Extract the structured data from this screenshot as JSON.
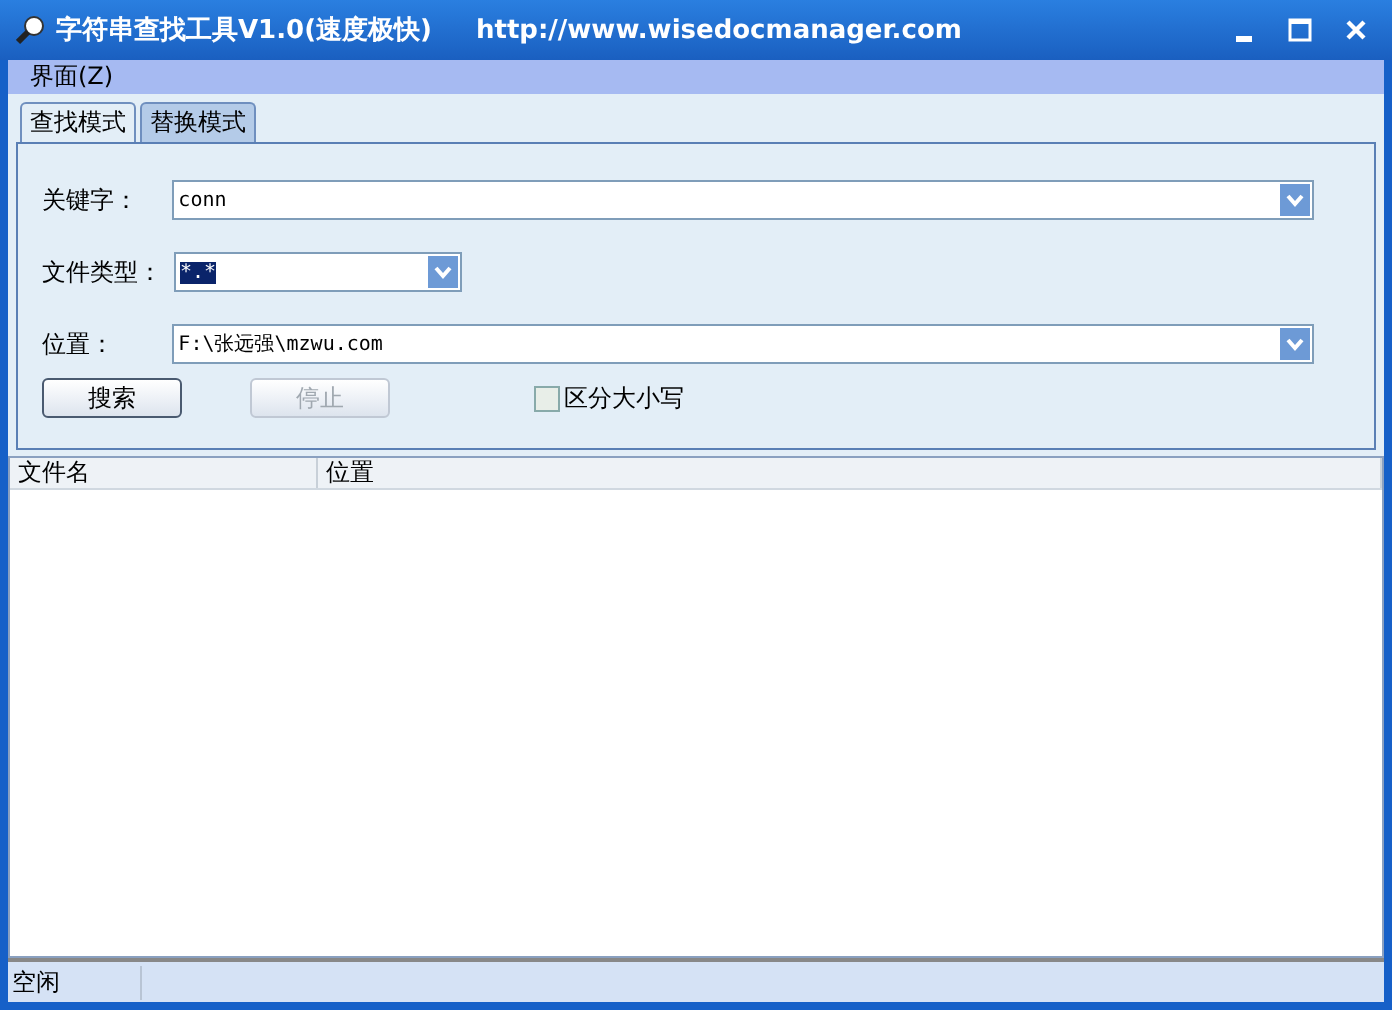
{
  "window": {
    "title": "字符串查找工具V1.0(速度极快)",
    "url": "http://www.wisedocmanager.com"
  },
  "menu": [
    {
      "label": "界面(Z)"
    }
  ],
  "tabs": [
    {
      "label": "查找模式",
      "selected": true
    },
    {
      "label": "替换模式",
      "selected": false
    }
  ],
  "fields": [
    {
      "label": "关键字：",
      "value": "conn",
      "kind": "wide",
      "highlighted": false
    },
    {
      "label": "文件类型：",
      "value": "*.*",
      "kind": "narrow",
      "highlighted": true
    },
    {
      "label": "位置：",
      "value": "F:\\张远强\\mzwu.com",
      "kind": "wide",
      "highlighted": false
    }
  ],
  "buttons": [
    {
      "label": "搜索",
      "disabled": false
    },
    {
      "label": "停止",
      "disabled": true
    }
  ],
  "checkbox": {
    "label": "区分大小写",
    "checked": false
  },
  "table": {
    "columns": [
      "文件名",
      "位置"
    ]
  },
  "status_bar": {
    "text": "空闲"
  }
}
